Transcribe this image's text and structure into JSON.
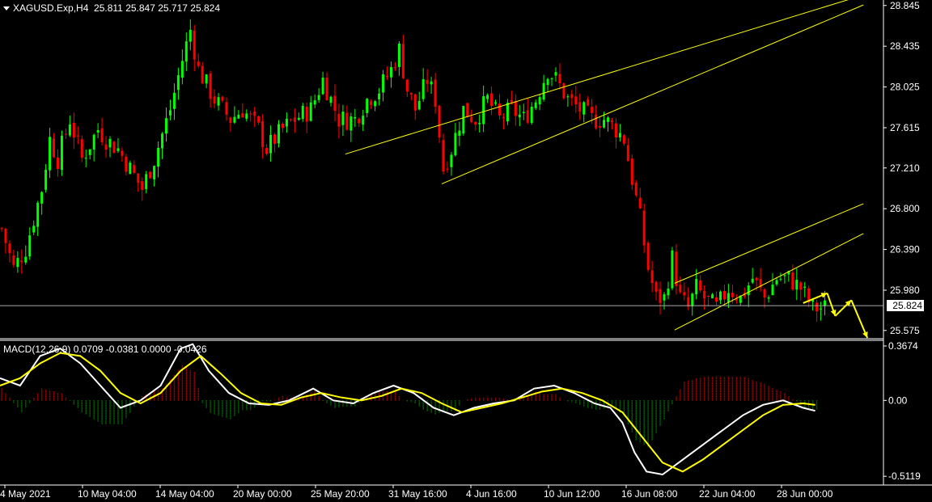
{
  "header": {
    "symbol": "XAGUSD.Exp,H4",
    "open": "25.811",
    "high": "25.847",
    "low": "25.717",
    "close": "25.824"
  },
  "current_price": "25.824",
  "macd_label": {
    "name": "MACD(12,26,9)",
    "values": "0.0709 -0.0381 0.0000 -0.0426"
  },
  "colors": {
    "bull": "#00ff00",
    "bear": "#ff0000",
    "channel": "#ffff00",
    "macd_main": "#ffffff",
    "macd_signal": "#ffff00",
    "hist_pos": "#ff0000",
    "hist_neg": "#00a000",
    "axis": "#ffffff",
    "arrow": "#ffff00"
  },
  "chart_data": [
    {
      "type": "candlestick",
      "title": "XAGUSD.Exp,H4",
      "y_ticks": [
        28.845,
        28.435,
        28.025,
        27.615,
        27.21,
        26.8,
        26.39,
        25.98,
        25.575
      ],
      "ylim": [
        25.5,
        28.9
      ],
      "x_ticks": [
        "4 May 2021",
        "10 May 04:00",
        "14 May 04:00",
        "20 May 00:00",
        "25 May 20:00",
        "31 May 16:00",
        "4 Jun 16:00",
        "10 Jun 12:00",
        "16 Jun 08:00",
        "22 Jun 04:00",
        "28 Jun 00:00"
      ],
      "close_path": [
        [
          0,
          26.6
        ],
        [
          3,
          26.2
        ],
        [
          6,
          26.4
        ],
        [
          10,
          27.0
        ],
        [
          12,
          27.5
        ],
        [
          14,
          27.3
        ],
        [
          17,
          27.7
        ],
        [
          20,
          27.3
        ],
        [
          24,
          27.6
        ],
        [
          26,
          27.5
        ],
        [
          29,
          27.4
        ],
        [
          32,
          27.2
        ],
        [
          35,
          27.0
        ],
        [
          38,
          27.3
        ],
        [
          42,
          27.8
        ],
        [
          45,
          28.3
        ],
        [
          47,
          28.6
        ],
        [
          49,
          28.2
        ],
        [
          53,
          27.9
        ],
        [
          57,
          27.7
        ],
        [
          60,
          27.8
        ],
        [
          64,
          27.6
        ],
        [
          66,
          27.4
        ],
        [
          70,
          27.6
        ],
        [
          73,
          27.7
        ],
        [
          77,
          27.8
        ],
        [
          80,
          28.1
        ],
        [
          84,
          27.7
        ],
        [
          88,
          27.7
        ],
        [
          91,
          27.9
        ],
        [
          94,
          28.0
        ],
        [
          97,
          28.2
        ],
        [
          99,
          28.4
        ],
        [
          101,
          28.0
        ],
        [
          103,
          27.8
        ],
        [
          106,
          28.1
        ],
        [
          108,
          27.9
        ],
        [
          110,
          27.2
        ],
        [
          112,
          27.4
        ],
        [
          115,
          27.8
        ],
        [
          118,
          27.7
        ],
        [
          121,
          27.9
        ],
        [
          124,
          27.7
        ],
        [
          127,
          27.8
        ],
        [
          130,
          27.7
        ],
        [
          133,
          27.9
        ],
        [
          136,
          28.2
        ],
        [
          138,
          28.1
        ],
        [
          141,
          27.9
        ],
        [
          144,
          27.8
        ],
        [
          147,
          27.7
        ],
        [
          150,
          27.7
        ],
        [
          153,
          27.6
        ],
        [
          155,
          27.5
        ],
        [
          157,
          27.1
        ],
        [
          159,
          26.7
        ],
        [
          161,
          26.2
        ],
        [
          163,
          25.9
        ],
        [
          165,
          25.9
        ],
        [
          167,
          26.3
        ],
        [
          169,
          25.9
        ],
        [
          171,
          25.8
        ],
        [
          173,
          26.0
        ],
        [
          175,
          25.9
        ],
        [
          178,
          25.8
        ],
        [
          181,
          26.0
        ],
        [
          184,
          25.9
        ],
        [
          187,
          26.1
        ],
        [
          190,
          25.9
        ],
        [
          193,
          26.1
        ],
        [
          196,
          26.1
        ],
        [
          199,
          26.0
        ],
        [
          202,
          25.8
        ],
        [
          205,
          25.8
        ]
      ],
      "channels": [
        {
          "p1": [
            86,
            27.35
          ],
          "p2": [
            215,
            28.95
          ]
        },
        {
          "p1": [
            110,
            27.05
          ],
          "p2": [
            215,
            28.85
          ]
        },
        {
          "p1": [
            168,
            26.05
          ],
          "p2": [
            215,
            26.85
          ]
        },
        {
          "p1": [
            168,
            25.58
          ],
          "p2": [
            215,
            26.55
          ]
        }
      ],
      "forecast_arrows": [
        [
          200,
          25.85
        ],
        [
          206,
          25.95
        ],
        [
          208,
          25.72
        ],
        [
          212,
          25.88
        ],
        [
          216,
          25.5
        ]
      ]
    },
    {
      "type": "line",
      "title": "MACD(12,26,9)",
      "y_ticks": [
        0.3674,
        0.0,
        -0.5119
      ],
      "ylim": [
        -0.56,
        0.4
      ],
      "series": [
        {
          "name": "main",
          "values": [
            [
              0,
              0.15
            ],
            [
              5,
              0.1
            ],
            [
              10,
              0.3
            ],
            [
              15,
              0.35
            ],
            [
              20,
              0.25
            ],
            [
              25,
              0.1
            ],
            [
              30,
              -0.05
            ],
            [
              35,
              0.0
            ],
            [
              40,
              0.1
            ],
            [
              45,
              0.35
            ],
            [
              48,
              0.38
            ],
            [
              52,
              0.2
            ],
            [
              57,
              0.05
            ],
            [
              62,
              -0.02
            ],
            [
              67,
              -0.03
            ],
            [
              72,
              0.0
            ],
            [
              78,
              0.08
            ],
            [
              83,
              0.0
            ],
            [
              88,
              -0.02
            ],
            [
              93,
              0.05
            ],
            [
              98,
              0.1
            ],
            [
              103,
              0.05
            ],
            [
              108,
              -0.05
            ],
            [
              113,
              -0.1
            ],
            [
              118,
              -0.05
            ],
            [
              123,
              -0.02
            ],
            [
              128,
              0.0
            ],
            [
              133,
              0.08
            ],
            [
              138,
              0.1
            ],
            [
              143,
              0.05
            ],
            [
              148,
              -0.02
            ],
            [
              152,
              -0.05
            ],
            [
              155,
              -0.15
            ],
            [
              158,
              -0.35
            ],
            [
              161,
              -0.48
            ],
            [
              165,
              -0.5
            ],
            [
              170,
              -0.4
            ],
            [
              175,
              -0.3
            ],
            [
              180,
              -0.2
            ],
            [
              185,
              -0.1
            ],
            [
              190,
              -0.03
            ],
            [
              195,
              0.0
            ],
            [
              200,
              -0.05
            ],
            [
              203,
              -0.07
            ]
          ]
        },
        {
          "name": "signal",
          "values": [
            [
              0,
              0.1
            ],
            [
              5,
              0.15
            ],
            [
              10,
              0.25
            ],
            [
              15,
              0.32
            ],
            [
              20,
              0.3
            ],
            [
              25,
              0.2
            ],
            [
              30,
              0.05
            ],
            [
              35,
              -0.02
            ],
            [
              40,
              0.05
            ],
            [
              45,
              0.2
            ],
            [
              50,
              0.3
            ],
            [
              55,
              0.18
            ],
            [
              60,
              0.05
            ],
            [
              65,
              -0.02
            ],
            [
              70,
              -0.03
            ],
            [
              75,
              0.02
            ],
            [
              80,
              0.05
            ],
            [
              85,
              0.02
            ],
            [
              90,
              0.0
            ],
            [
              95,
              0.03
            ],
            [
              100,
              0.08
            ],
            [
              105,
              0.05
            ],
            [
              110,
              -0.02
            ],
            [
              115,
              -0.08
            ],
            [
              120,
              -0.05
            ],
            [
              125,
              -0.02
            ],
            [
              130,
              0.02
            ],
            [
              135,
              0.06
            ],
            [
              140,
              0.08
            ],
            [
              145,
              0.05
            ],
            [
              150,
              0.0
            ],
            [
              155,
              -0.08
            ],
            [
              160,
              -0.25
            ],
            [
              165,
              -0.42
            ],
            [
              170,
              -0.48
            ],
            [
              175,
              -0.4
            ],
            [
              180,
              -0.3
            ],
            [
              185,
              -0.2
            ],
            [
              190,
              -0.1
            ],
            [
              195,
              -0.03
            ],
            [
              200,
              -0.02
            ],
            [
              203,
              -0.03
            ]
          ]
        }
      ]
    }
  ]
}
